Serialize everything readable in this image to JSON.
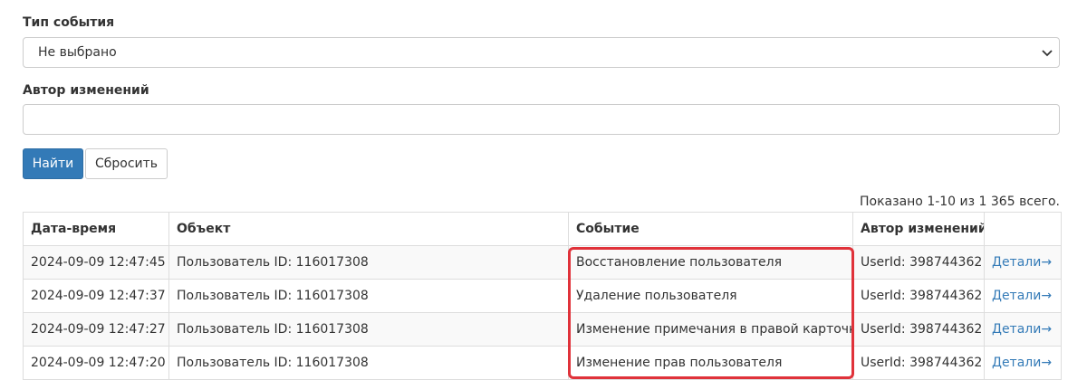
{
  "filters": {
    "event_type_label": "Тип события",
    "event_type_value": "Не выбрано",
    "author_label": "Автор изменений",
    "author_value": "",
    "find_button": "Найти",
    "reset_button": "Сбросить"
  },
  "summary": "Показано 1-10 из 1 365 всего.",
  "table": {
    "headers": {
      "datetime": "Дата-время",
      "object": "Объект",
      "event": "Событие",
      "author": "Автор изменений"
    },
    "rows": [
      {
        "datetime": "2024-09-09 12:47:45",
        "object": "Пользователь ID: 116017308",
        "event": "Восстановление пользователя",
        "author": "UserId: 398744362",
        "details": "Детали→"
      },
      {
        "datetime": "2024-09-09 12:47:37",
        "object": "Пользователь ID: 116017308",
        "event": "Удаление пользователя",
        "author": "UserId: 398744362",
        "details": "Детали→"
      },
      {
        "datetime": "2024-09-09 12:47:27",
        "object": "Пользователь ID: 116017308",
        "event": "Изменение примечания в правой карточке",
        "author": "UserId: 398744362",
        "details": "Детали→"
      },
      {
        "datetime": "2024-09-09 12:47:20",
        "object": "Пользователь ID: 116017308",
        "event": "Изменение прав пользователя",
        "author": "UserId: 398744362",
        "details": "Детали→"
      }
    ]
  },
  "colors": {
    "primary": "#337ab7",
    "highlight": "#e0323a"
  }
}
